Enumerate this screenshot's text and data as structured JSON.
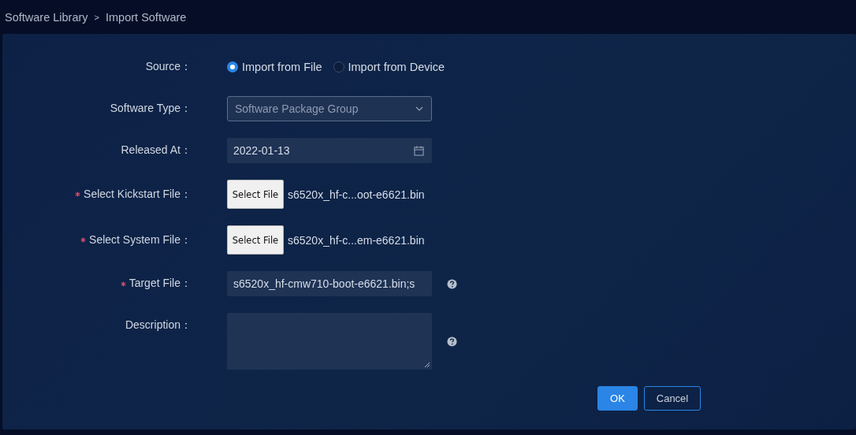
{
  "breadcrumb": {
    "items": [
      {
        "label": "Software Library"
      },
      {
        "label": "Import Software"
      }
    ],
    "separator": ">"
  },
  "form": [
    {
      "kind": "radio",
      "label": "Source：",
      "required": false,
      "options": [
        {
          "label": "Import from File",
          "selected": true
        },
        {
          "label": "Import from Device",
          "selected": false
        }
      ]
    },
    {
      "kind": "select",
      "label": "Software Type：",
      "required": false,
      "value": "Software Package Group"
    },
    {
      "kind": "date",
      "label": "Released At：",
      "required": false,
      "value": "2022-01-13"
    },
    {
      "kind": "file",
      "label": "Select Kickstart File：",
      "required": true,
      "button": "Select File",
      "value": "s6520x_hf-c...oot-e6621.bin"
    },
    {
      "kind": "file",
      "label": "Select System File：",
      "required": true,
      "button": "Select File",
      "value": "s6520x_hf-c...em-e6621.bin"
    },
    {
      "kind": "text",
      "label": "Target File：",
      "required": true,
      "value": "s6520x_hf-cmw710-boot-e6621.bin;s",
      "help": true
    },
    {
      "kind": "textarea",
      "label": "Description：",
      "required": false,
      "help": true
    }
  ],
  "buttons": [
    {
      "label": "OK",
      "primary": true
    },
    {
      "label": "Cancel",
      "primary": false
    }
  ]
}
